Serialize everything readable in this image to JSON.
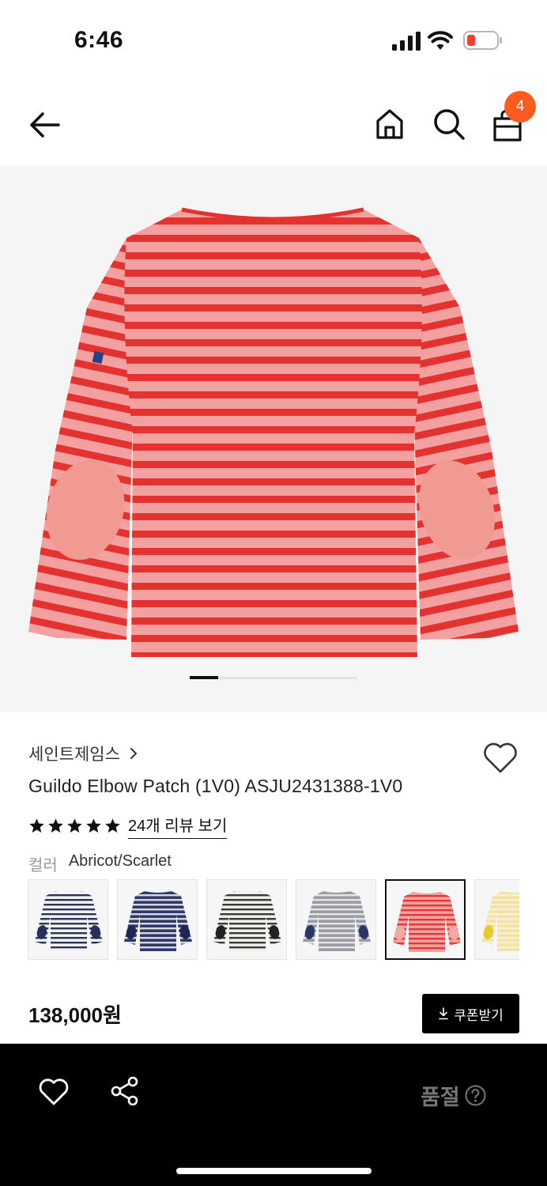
{
  "status_bar": {
    "time": "6:46",
    "battery_color": "#ff3b30"
  },
  "nav": {
    "back_icon": "arrow-left-icon",
    "home_icon": "home-icon",
    "search_icon": "search-icon",
    "cart_icon": "cart-icon",
    "cart_count": "4",
    "badge_color": "#ff5a1f"
  },
  "gallery": {
    "current_index": 1
  },
  "product": {
    "brand": "세인트제임스",
    "name": "Guildo Elbow Patch (1V0) ASJU2431388-1V0",
    "rating": 5,
    "review_link": "24개 리뷰 보기",
    "color_label": "컬러",
    "color_value": "Abricot/Scarlet",
    "price": "138,000원",
    "coupon_label": "쿠폰받기"
  },
  "swatches": [
    {
      "name": "white-navy",
      "base": "#f2f2f2",
      "stripe": "#2a3558",
      "patch": "#26305a",
      "selected": false
    },
    {
      "name": "navy",
      "base": "#2f3a6b",
      "stripe": "#d8d8de",
      "patch": "#1e274f",
      "selected": false
    },
    {
      "name": "white-black",
      "base": "#efefe8",
      "stripe": "#3a3a3a",
      "patch": "#222222",
      "selected": false
    },
    {
      "name": "grey-navy",
      "base": "#9a9ca3",
      "stripe": "#e5e5e8",
      "patch": "#2b3566",
      "selected": false
    },
    {
      "name": "abricot-scarlet",
      "base": "#f2a0a0",
      "stripe": "#e03a36",
      "patch": "#f0a8a2",
      "selected": true
    },
    {
      "name": "yellow",
      "base": "#f2e2a6",
      "stripe": "#f7f1d8",
      "patch": "#e6c930",
      "selected": false
    }
  ],
  "bottom_bar": {
    "sold_out_label": "품절"
  }
}
